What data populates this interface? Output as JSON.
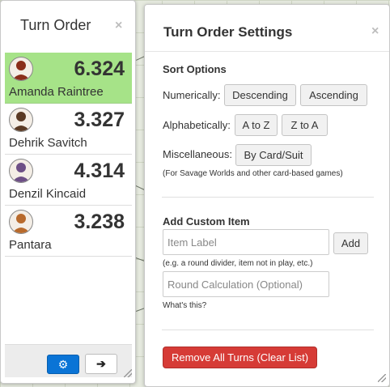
{
  "turn_order": {
    "title": "Turn Order",
    "close_glyph": "×",
    "entries": [
      {
        "name": "Amanda Raintree",
        "value": "6.324",
        "active": true,
        "avatar_color": "#8a2e1a"
      },
      {
        "name": "Dehrik Savitch",
        "value": "3.327",
        "active": false,
        "avatar_color": "#5a3a24"
      },
      {
        "name": "Denzil Kincaid",
        "value": "4.314",
        "active": false,
        "avatar_color": "#6d4f86"
      },
      {
        "name": "Pantara",
        "value": "3.238",
        "active": false,
        "avatar_color": "#b86a2c"
      }
    ],
    "footer": {
      "settings_icon": "gear-icon",
      "settings_glyph": "⚙",
      "next_icon": "arrow-right-icon",
      "next_glyph": "➔"
    }
  },
  "settings": {
    "title": "Turn Order Settings",
    "close_glyph": "×",
    "sort_options": {
      "title": "Sort Options",
      "numerically_label": "Numerically:",
      "descending": "Descending",
      "ascending": "Ascending",
      "alphabetically_label": "Alphabetically:",
      "a_to_z": "A to Z",
      "z_to_a": "Z to A",
      "misc_label": "Miscellaneous:",
      "by_card_suit": "By Card/Suit",
      "misc_note": "(For Savage Worlds and other card-based games)"
    },
    "custom_item": {
      "title": "Add Custom Item",
      "label_placeholder": "Item Label",
      "add_button": "Add",
      "label_note": "(e.g. a round divider, item not in play, etc.)",
      "calc_placeholder": "Round Calculation (Optional)",
      "help_link": "What's this?"
    },
    "remove_all": "Remove All Turns (Clear List)"
  },
  "colors": {
    "active_row": "#a6e388",
    "primary_button": "#0a74d6",
    "danger_button": "#d63b36"
  }
}
